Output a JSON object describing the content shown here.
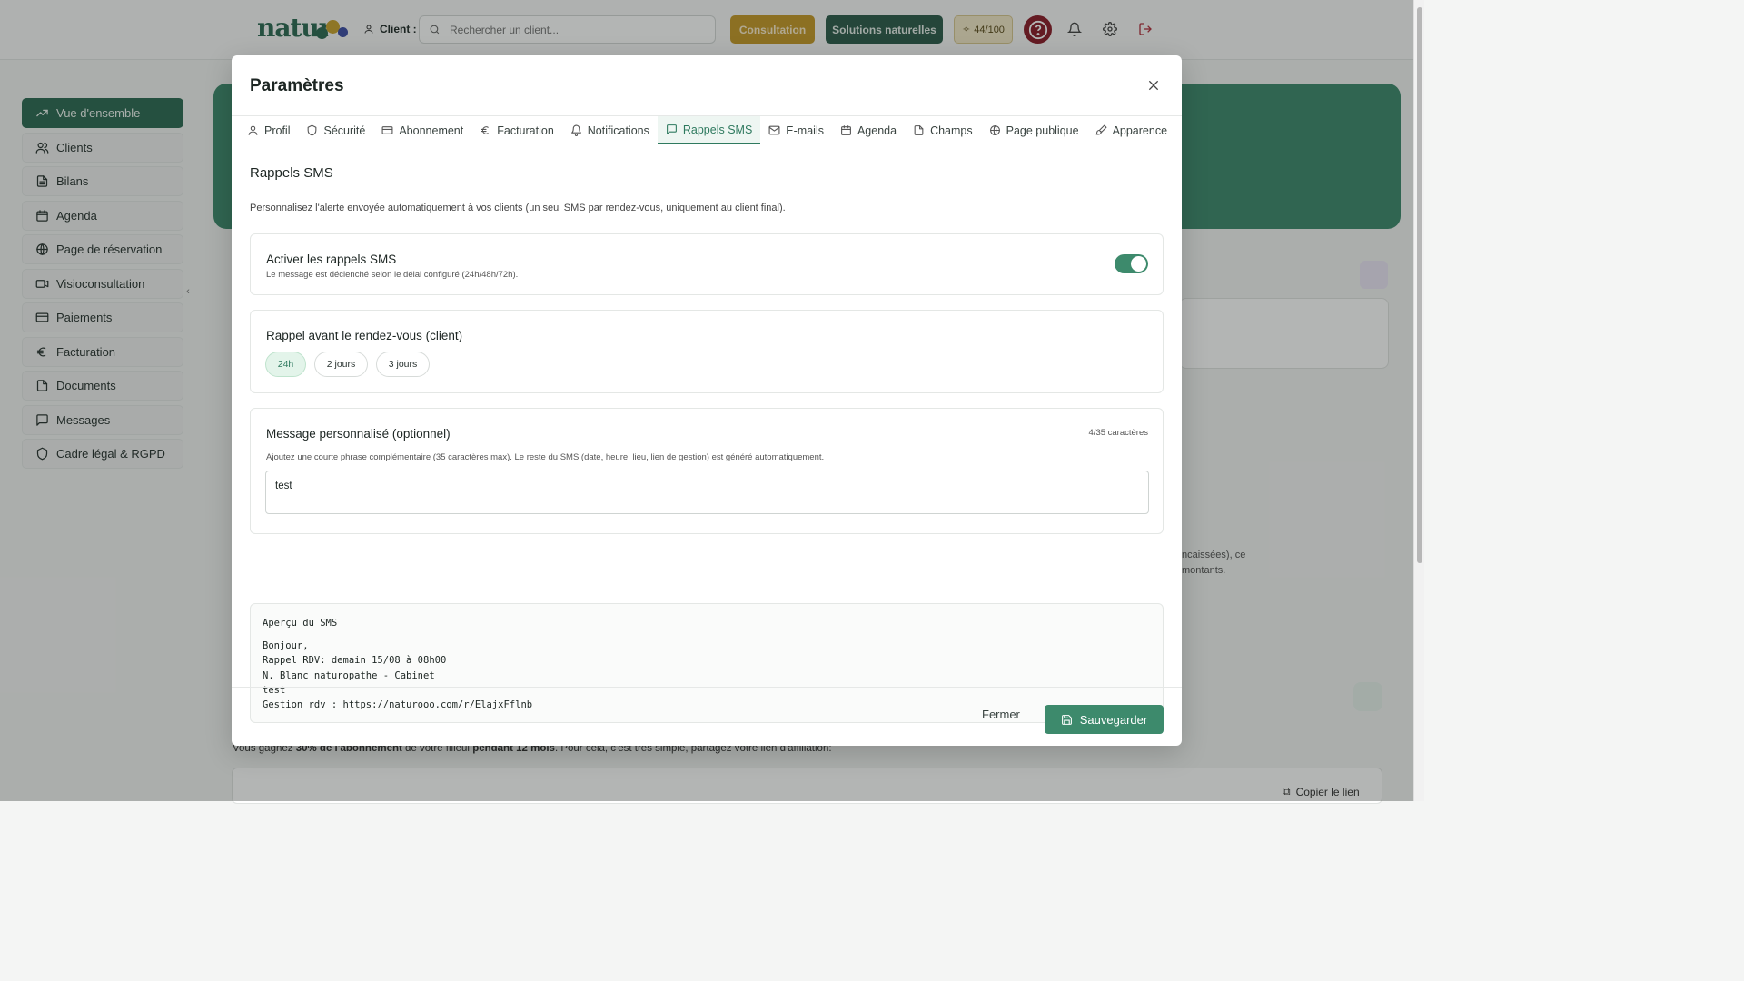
{
  "topbar": {
    "logo_text": "natur",
    "client_label": "Client :",
    "search_placeholder": "Rechercher un client...",
    "consultation_label": "Consultation",
    "solutions_label": "Solutions naturelles",
    "score_label": "44/100"
  },
  "sidebar": {
    "items": [
      {
        "label": "Vue d'ensemble",
        "icon": "trending-up-icon"
      },
      {
        "label": "Clients",
        "icon": "users-icon"
      },
      {
        "label": "Bilans",
        "icon": "file-text-icon"
      },
      {
        "label": "Agenda",
        "icon": "calendar-icon"
      },
      {
        "label": "Page de réservation",
        "icon": "globe-icon"
      },
      {
        "label": "Visioconsultation",
        "icon": "video-icon"
      },
      {
        "label": "Paiements",
        "icon": "credit-card-icon"
      },
      {
        "label": "Facturation",
        "icon": "euro-icon"
      },
      {
        "label": "Documents",
        "icon": "file-icon"
      },
      {
        "label": "Messages",
        "icon": "message-icon"
      },
      {
        "label": "Cadre légal & RGPD",
        "icon": "shield-icon"
      }
    ]
  },
  "background": {
    "affiliation_text_1": "Vous gagnez ",
    "affiliation_bold_1": "30% de l'abonnement",
    "affiliation_text_2": " de votre filleul ",
    "affiliation_bold_2": "pendant 12 mois",
    "affiliation_text_3": ". Pour cela, c'est très simple, partagez votre lien d'affiliation:",
    "copy_link_label": "Copier le lien",
    "partial_text_1": "ncaissées), ce",
    "partial_text_2": "montants."
  },
  "modal": {
    "title": "Paramètres",
    "tabs": [
      {
        "label": "Profil",
        "icon": "user-icon"
      },
      {
        "label": "Sécurité",
        "icon": "shield-icon"
      },
      {
        "label": "Abonnement",
        "icon": "credit-card-icon"
      },
      {
        "label": "Facturation",
        "icon": "euro-icon"
      },
      {
        "label": "Notifications",
        "icon": "bell-icon"
      },
      {
        "label": "Rappels SMS",
        "icon": "message-icon"
      },
      {
        "label": "E-mails",
        "icon": "mail-icon"
      },
      {
        "label": "Agenda",
        "icon": "calendar-icon"
      },
      {
        "label": "Champs",
        "icon": "file-icon"
      },
      {
        "label": "Page publique",
        "icon": "globe-icon"
      },
      {
        "label": "Apparence",
        "icon": "brush-icon"
      }
    ],
    "active_tab": "Rappels SMS",
    "section_title": "Rappels SMS",
    "section_description": "Personnalisez l'alerte envoyée automatiquement à vos clients (un seul SMS par rendez-vous, uniquement au client final).",
    "activate": {
      "title": "Activer les rappels SMS",
      "subtitle": "Le message est déclenché selon le délai configuré (24h/48h/72h).",
      "enabled": true
    },
    "reminder": {
      "title": "Rappel avant le rendez-vous (client)",
      "options": [
        "24h",
        "2 jours",
        "3 jours"
      ],
      "selected": "24h"
    },
    "custom_message": {
      "title": "Message personnalisé (optionnel)",
      "counter": "4/35 caractères",
      "help": "Ajoutez une courte phrase complémentaire (35 caractères max). Le reste du SMS (date, heure, lieu, lien de gestion) est généré automatiquement.",
      "value": "test"
    },
    "preview": {
      "title": "Aperçu du SMS",
      "lines": [
        "Bonjour,",
        "Rappel RDV: demain 15/08 à 08h00",
        "N. Blanc naturopathe - Cabinet",
        "test",
        "Gestion rdv : https://naturooo.com/r/ElajxFflnb"
      ]
    },
    "footer": {
      "close_label": "Fermer",
      "save_label": "Sauvegarder"
    }
  },
  "colors": {
    "brand_green": "#2f6b55",
    "accent_green": "#3d8a6c",
    "consultation_gold": "#c69a2a",
    "help_red": "#8b1d2a"
  }
}
